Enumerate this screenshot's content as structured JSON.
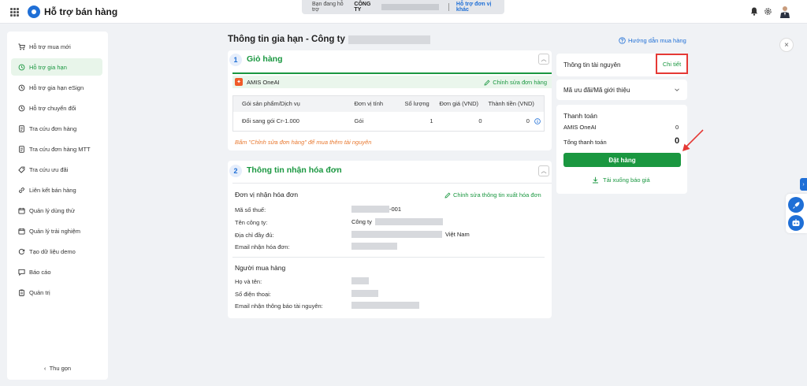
{
  "header": {
    "app_title": "Hỗ trợ bán hàng",
    "support_label": "Bạn đang hỗ trợ",
    "support_company": "CÔNG TY",
    "switch_unit_link": "Hỗ trợ đơn vị khác"
  },
  "sidebar": {
    "items": [
      {
        "label": "Hỗ trợ mua mới",
        "icon": "cart-icon",
        "active": false
      },
      {
        "label": "Hỗ trợ gia hạn",
        "icon": "history-icon",
        "active": true
      },
      {
        "label": "Hỗ trợ gia hạn eSign",
        "icon": "history-icon",
        "active": false
      },
      {
        "label": "Hỗ trợ chuyển đổi",
        "icon": "history-icon",
        "active": false
      },
      {
        "label": "Tra cứu đơn hàng",
        "icon": "document-icon",
        "active": false
      },
      {
        "label": "Tra cứu đơn hàng MTT",
        "icon": "document-icon",
        "active": false
      },
      {
        "label": "Tra cứu ưu đãi",
        "icon": "tag-icon",
        "active": false
      },
      {
        "label": "Liên kết bán hàng",
        "icon": "link-icon",
        "active": false
      },
      {
        "label": "Quản lý dùng thử",
        "icon": "calendar-icon",
        "active": false
      },
      {
        "label": "Quản lý trải nghiệm",
        "icon": "calendar-icon",
        "active": false
      },
      {
        "label": "Tạo dữ liệu demo",
        "icon": "refresh-icon",
        "active": false
      },
      {
        "label": "Báo cáo",
        "icon": "chat-icon",
        "active": false
      },
      {
        "label": "Quản trị",
        "icon": "clipboard-icon",
        "active": false
      }
    ],
    "collapse_label": "Thu gọn"
  },
  "main": {
    "page_title": "Thông tin gia hạn - Công ty",
    "guide_link": "Hướng dẫn mua hàng",
    "cart": {
      "number": "1",
      "title": "Giỏ hàng",
      "product_name": "AMIS OneAI",
      "edit_order_link": "Chỉnh sửa đơn hàng",
      "columns": [
        "Gói sản phẩm/Dịch vụ",
        "Đơn vị tính",
        "Số lượng",
        "Đơn giá (VND)",
        "Thành tiền (VND)"
      ],
      "rows": [
        {
          "package": "Đổi sang gói Cr-1.000",
          "unit": "Gói",
          "quantity": "1",
          "unit_price": "0",
          "total": "0"
        }
      ],
      "hint": "Bấm \"Chỉnh sửa đơn hàng\" để mua thêm tài nguyên"
    },
    "invoice": {
      "number": "2",
      "title": "Thông tin nhận hóa đơn",
      "receiver_heading": "Đơn vị nhận hóa đơn",
      "edit_invoice_link": "Chỉnh sửa thông tin xuất hóa đơn",
      "tax_code_label": "Mã số thuế:",
      "tax_code_suffix": "-001",
      "company_label": "Tên công ty:",
      "company_prefix": "Công ty",
      "address_label": "Địa chỉ đầy đủ:",
      "address_suffix": "Việt Nam",
      "email_label": "Email nhận hóa đơn:",
      "buyer_heading": "Người mua hàng",
      "name_label": "Họ và tên:",
      "phone_label": "Số điện thoại:",
      "notify_email_label": "Email nhận thông báo tài nguyên:"
    }
  },
  "right": {
    "resource_info_label": "Thông tin tài nguyên",
    "detail_link": "Chi tiết",
    "promo_label": "Mã ưu đãi/Mã giới thiệu",
    "payment_title": "Thanh toán",
    "product_line": "AMIS OneAI",
    "product_amount": "0",
    "total_label": "Tổng thanh toán",
    "total_amount": "0",
    "order_button": "Đặt hàng",
    "download_quote": "Tải xuống báo giá"
  },
  "colors": {
    "accent_green": "#1a9740",
    "brand_blue": "#1f6fd6",
    "highlight_red": "#e53935",
    "hint_orange": "#e8782f"
  }
}
